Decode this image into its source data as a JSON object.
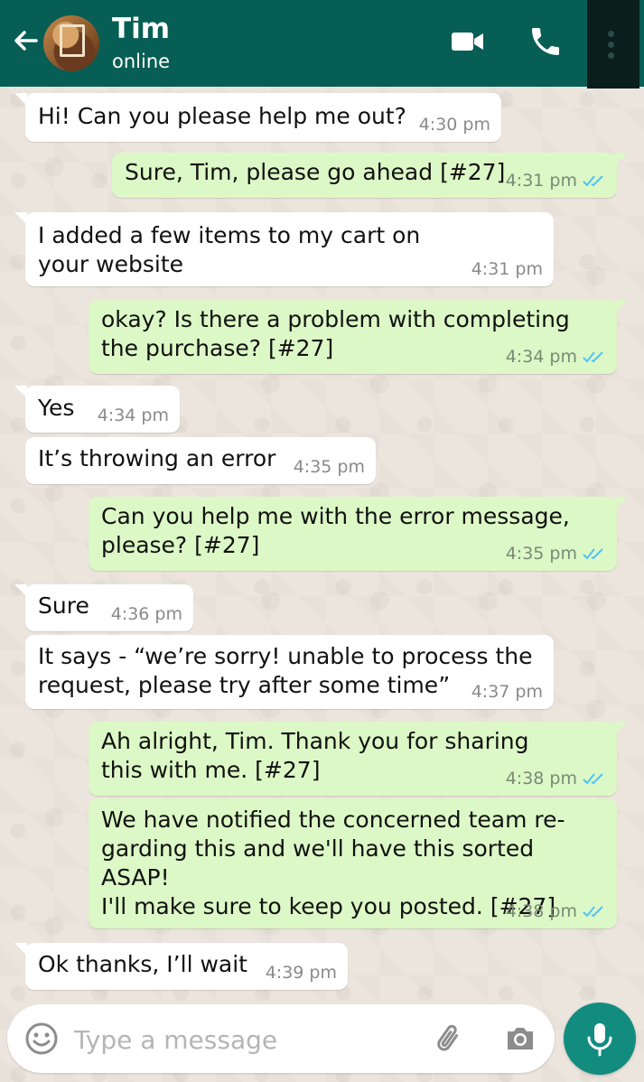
{
  "header": {
    "contact_name": "Tim",
    "contact_status": "online",
    "icons": [
      "back-arrow-icon",
      "video-call-icon",
      "phone-call-icon",
      "more-options-icon"
    ]
  },
  "messages": [
    {
      "direction": "in",
      "text": "Hi! Can you please help me out?",
      "time": "4:30 pm"
    },
    {
      "direction": "out",
      "text": "Sure, Tim, please go ahead [#27]",
      "time": "4:31 pm",
      "status": "read"
    },
    {
      "direction": "in",
      "text": "I added a few items to my cart on\nyour website",
      "time": "4:31 pm"
    },
    {
      "direction": "out",
      "text": "okay? Is there a problem with completing\nthe purchase? [#27]",
      "time": "4:34 pm",
      "status": "read"
    },
    {
      "direction": "in",
      "text": "Yes",
      "time": "4:34 pm"
    },
    {
      "direction": "in",
      "text": "It’s throwing an error",
      "time": "4:35 pm"
    },
    {
      "direction": "out",
      "text": "Can you help me with the error message,\nplease? [#27]",
      "time": "4:35 pm",
      "status": "read"
    },
    {
      "direction": "in",
      "text": "Sure",
      "time": "4:36 pm"
    },
    {
      "direction": "in",
      "text": "It says - “we’re sorry! unable to process the\nrequest, please try after some time”",
      "time": "4:37 pm"
    },
    {
      "direction": "out",
      "text": "Ah alright, Tim. Thank you for sharing\nthis with me. [#27]",
      "time": "4:38 pm",
      "status": "read"
    },
    {
      "direction": "out",
      "text": "We have notified the concerned team re-\ngarding this and we'll have this sorted ASAP!\nI'll make sure to keep you posted. [#27]",
      "time": "4:38 pm",
      "status": "read"
    },
    {
      "direction": "in",
      "text": "Ok thanks, I’ll wait",
      "time": "4:39 pm"
    }
  ],
  "composer": {
    "placeholder": "Type a message",
    "value": "",
    "icons": [
      "emoji-icon",
      "attachment-icon",
      "camera-icon",
      "microphone-icon"
    ]
  },
  "colors": {
    "header_bg": "#075e54",
    "outgoing_bubble": "#dcf8c6",
    "incoming_bubble": "#ffffff",
    "read_tick": "#4fc3f7",
    "mic_button": "#128c7e"
  }
}
